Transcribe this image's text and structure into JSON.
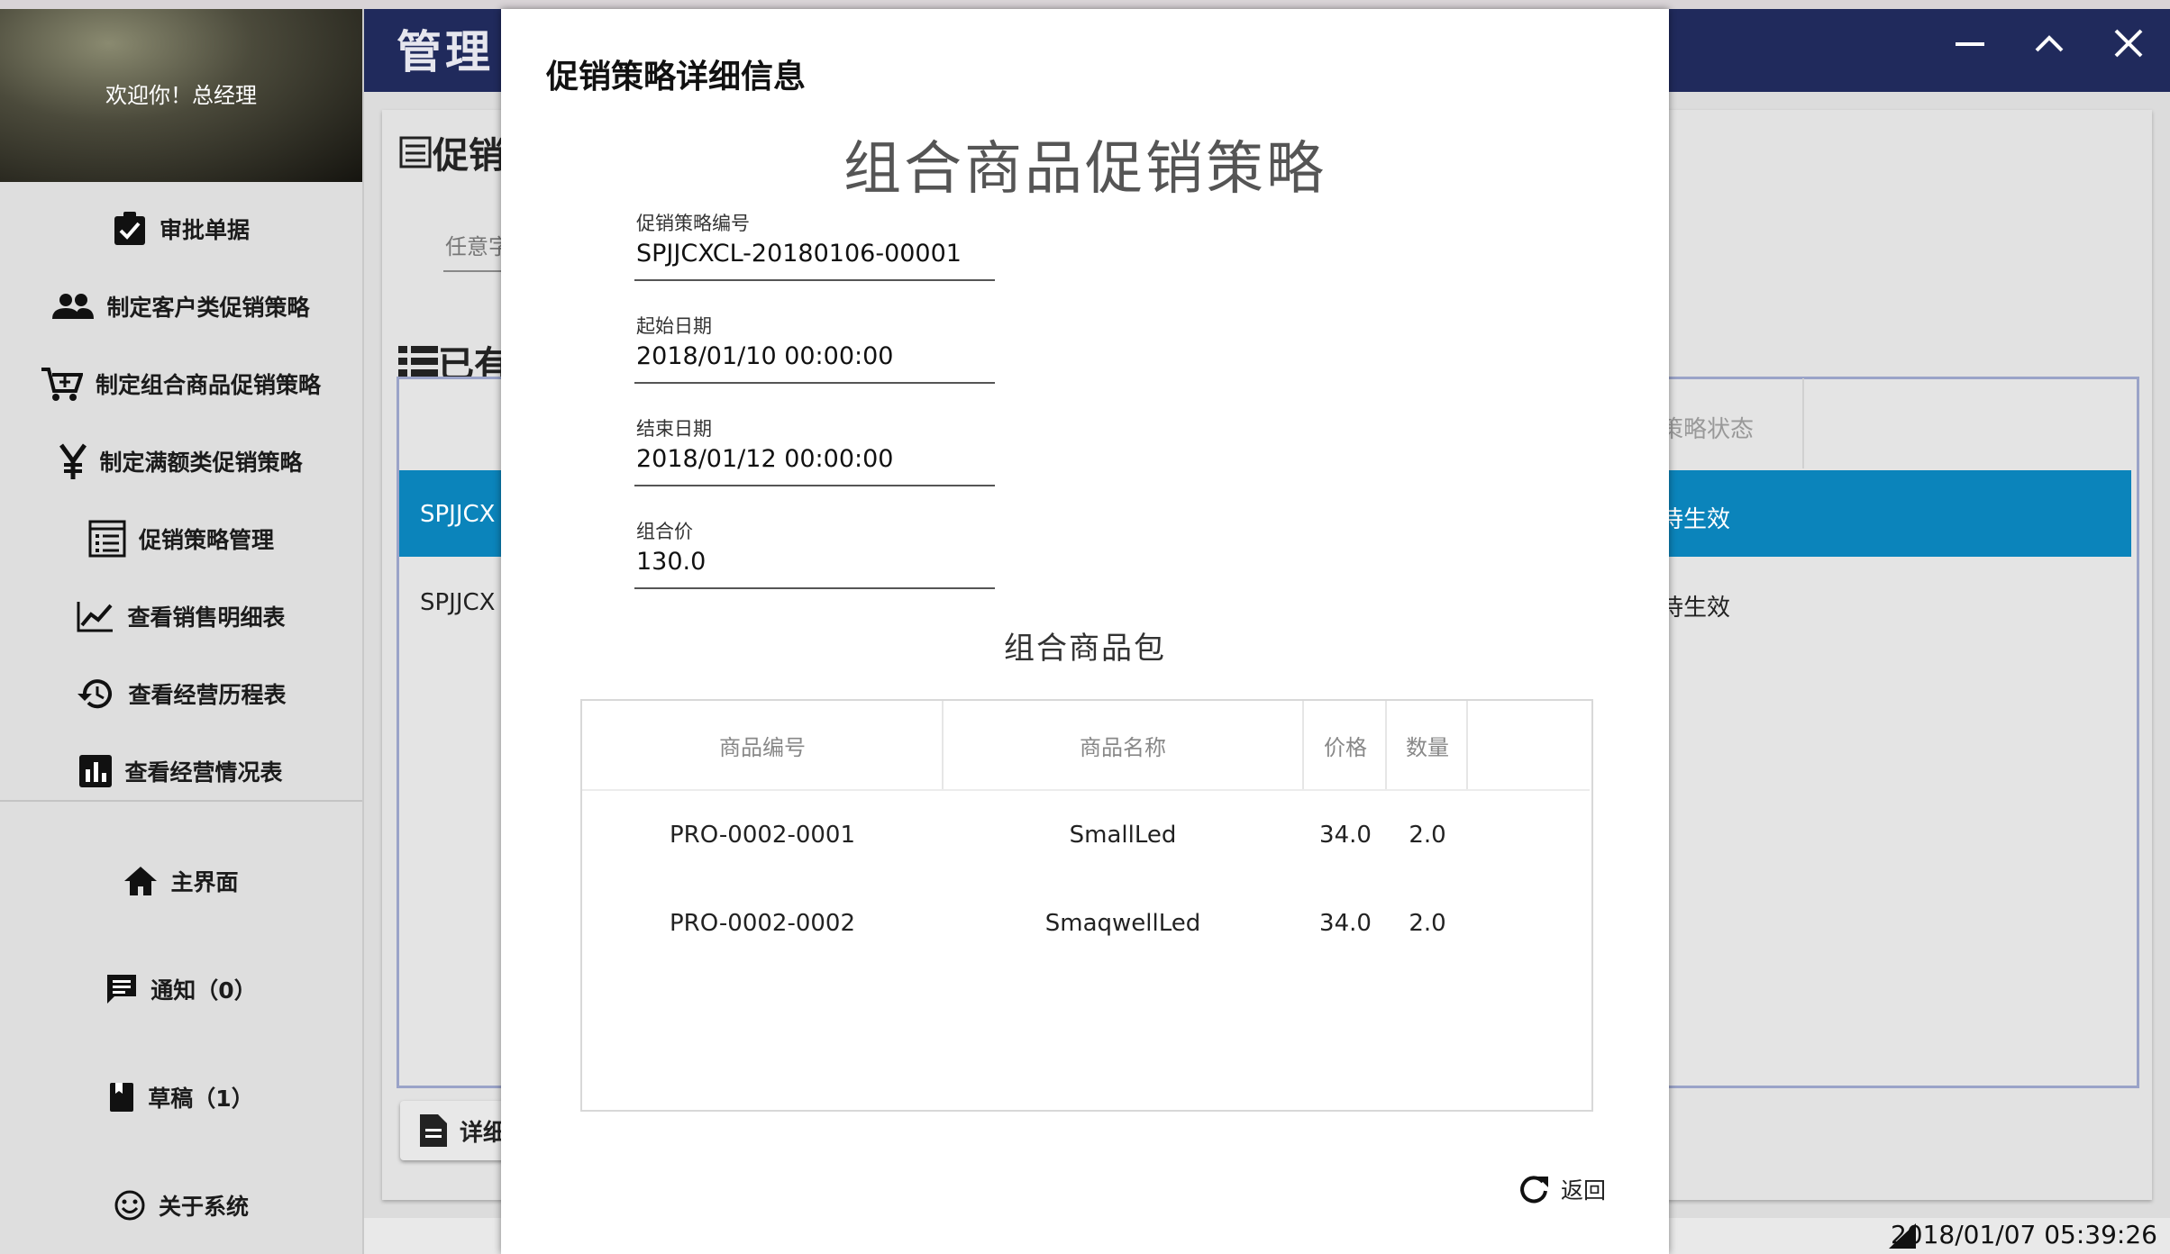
{
  "app": {
    "title": "管理",
    "welcome": "欢迎你！总经理",
    "accent": "#202a5c",
    "selection_color": "#0b84bb"
  },
  "sidebar": {
    "items": [
      {
        "label": "审批单据",
        "icon": "clipboard-check-icon"
      },
      {
        "label": "制定客户类促销策略",
        "icon": "users-icon"
      },
      {
        "label": "制定组合商品促销策略",
        "icon": "cart-icon"
      },
      {
        "label": "制定满额类促销策略",
        "icon": "yen-icon"
      },
      {
        "label": "促销策略管理",
        "icon": "list-box-icon"
      },
      {
        "label": "查看销售明细表",
        "icon": "trend-chart-icon"
      },
      {
        "label": "查看经营历程表",
        "icon": "history-icon"
      },
      {
        "label": "查看经营情况表",
        "icon": "bar-chart-icon"
      }
    ],
    "bottom_items": [
      {
        "label": "主界面",
        "icon": "home-icon"
      },
      {
        "label": "通知（0）",
        "icon": "message-icon"
      },
      {
        "label": "草稿（1）",
        "icon": "book-icon"
      },
      {
        "label": "关于系统",
        "icon": "smile-icon"
      }
    ]
  },
  "background": {
    "content_title": "促销",
    "search_label": "任意字",
    "list_title": "已有",
    "status_column": "策略状态",
    "rows": [
      {
        "id": "SPJJCX",
        "status": "待生效"
      },
      {
        "id": "SPJJCX",
        "status": "待生效"
      }
    ],
    "detail_button": "详细",
    "timestamp": "2018/01/07 05:39:26"
  },
  "dialog": {
    "header": "促销策略详细信息",
    "main_title": "组合商品促销策略",
    "fields": [
      {
        "label": "促销策略编号",
        "value": "SPJJCXCL-20180106-00001"
      },
      {
        "label": "起始日期",
        "value": "2018/01/10 00:00:00"
      },
      {
        "label": "结束日期",
        "value": "2018/01/12 00:00:00"
      },
      {
        "label": "组合价",
        "value": "130.0"
      }
    ],
    "bundle_title": "组合商品包",
    "table": {
      "headers": [
        "商品编号",
        "商品名称",
        "价格",
        "数量"
      ],
      "rows": [
        [
          "PRO-0002-0001",
          "SmallLed",
          "34.0",
          "2.0"
        ],
        [
          "PRO-0002-0002",
          "SmaqwellLed",
          "34.0",
          "2.0"
        ]
      ]
    },
    "back_label": "返回"
  }
}
